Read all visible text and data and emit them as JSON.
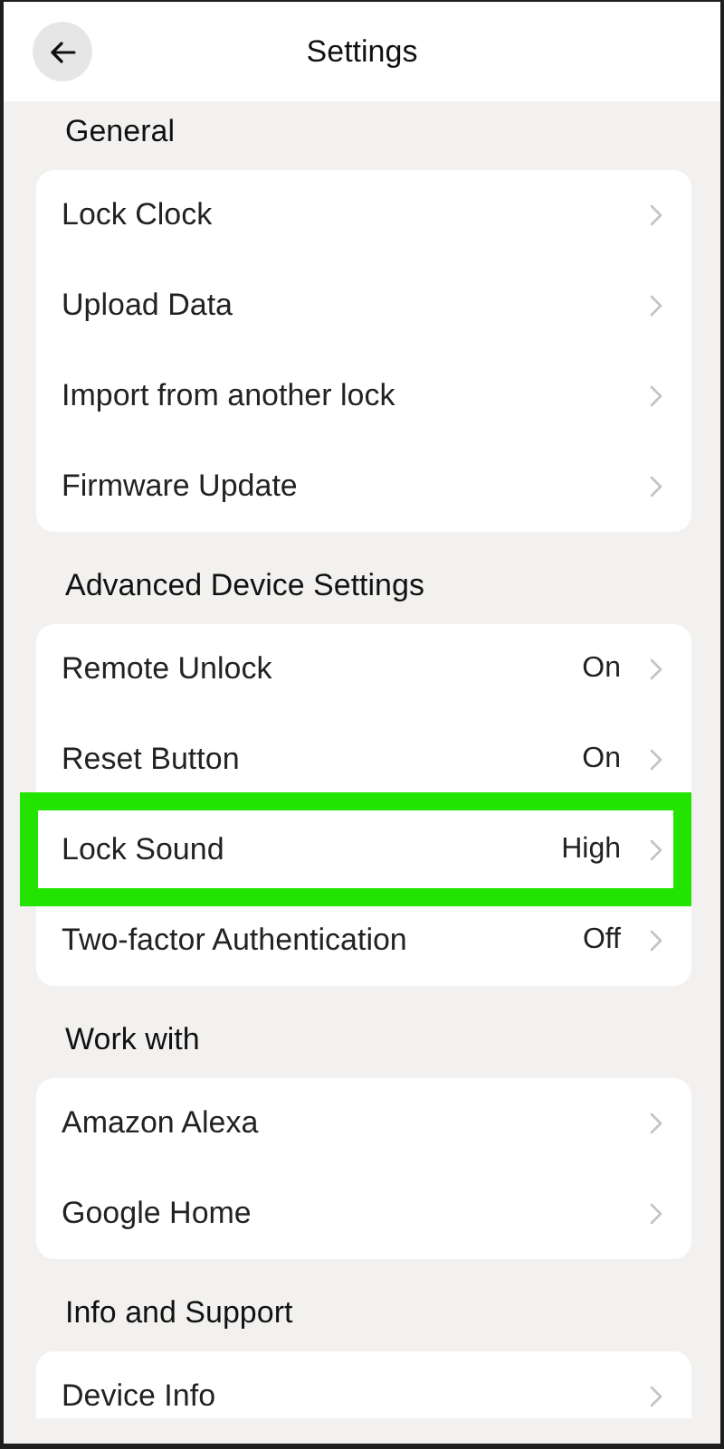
{
  "header": {
    "title": "Settings"
  },
  "sections": [
    {
      "title": "General",
      "items": [
        {
          "label": "Lock Clock",
          "highlighted": false
        },
        {
          "label": "Upload Data",
          "highlighted": false
        },
        {
          "label": "Import from another lock",
          "highlighted": false
        },
        {
          "label": "Firmware Update",
          "highlighted": false
        }
      ]
    },
    {
      "title": "Advanced Device Settings",
      "items": [
        {
          "label": "Remote Unlock",
          "value": "On",
          "highlighted": false
        },
        {
          "label": "Reset Button",
          "value": "On",
          "highlighted": false
        },
        {
          "label": "Lock Sound",
          "value": "High",
          "highlighted": true
        },
        {
          "label": "Two-factor Authentication",
          "value": "Off",
          "highlighted": false
        }
      ]
    },
    {
      "title": "Work with",
      "items": [
        {
          "label": "Amazon Alexa",
          "highlighted": false
        },
        {
          "label": "Google Home",
          "highlighted": false
        }
      ]
    },
    {
      "title": "Info and Support",
      "items": [
        {
          "label": "Device Info",
          "highlighted": false
        }
      ]
    }
  ]
}
